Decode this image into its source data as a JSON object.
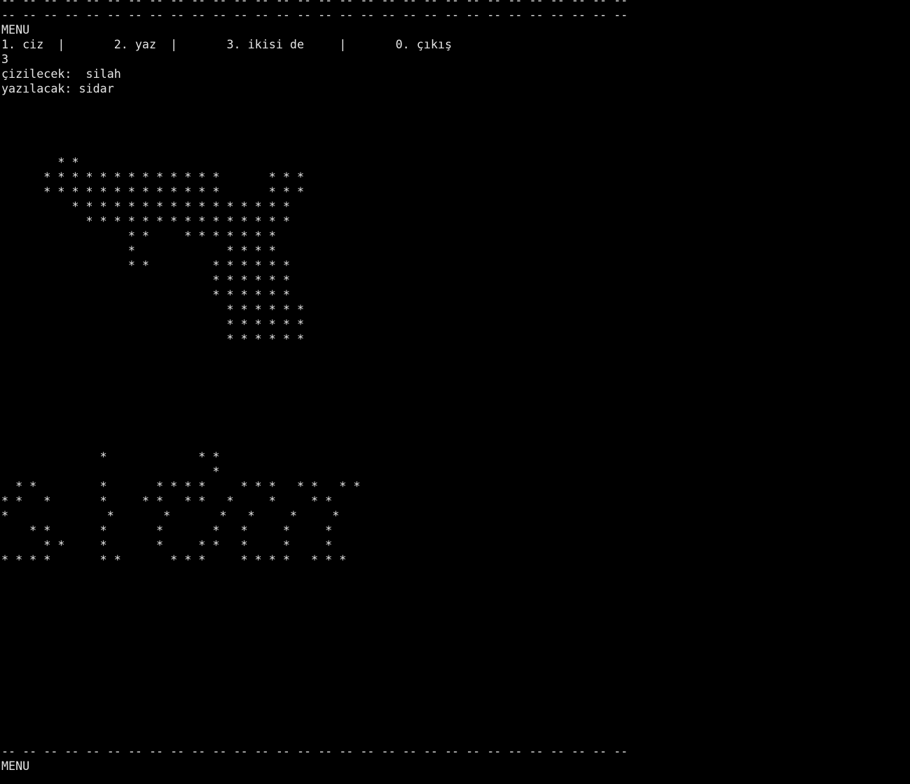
{
  "terminal": {
    "foreground": "#e6e6e6",
    "background": "#000000",
    "lines": [
      "-- -- -- -- -- -- -- -- -- -- -- -- -- -- -- -- -- -- -- -- -- -- -- -- -- -- -- -- -- --",
      "-- -- -- -- -- -- -- -- -- -- -- -- -- -- -- -- -- -- -- -- -- -- -- -- -- -- -- -- -- --",
      "MENU",
      "1. ciz  |       2. yaz  |       3. ikisi de     |       0. çıkış",
      "3",
      "çizilecek:  silah",
      "yazılacak: sidar",
      "",
      "",
      "",
      "",
      "        * *",
      "      * * * * * * * * * * * * *       * * *",
      "      * * * * * * * * * * * * *       * * *",
      "          * * * * * * * * * * * * * * * *",
      "            * * * * * * * * * * * * * * *",
      "                  * *     * * * * * * *",
      "                  *             * * * *",
      "                  * *         * * * * * *",
      "                              * * * * * *",
      "                              * * * * * *",
      "                                * * * * * *",
      "                                * * * * * *",
      "                                * * * * * *",
      "",
      "",
      "",
      "",
      "",
      "",
      "",
      "              *             * *",
      "                              *",
      "  * *         *       * * * *     * * *   * *   * *",
      "* *   *       *     * *   * *   *     *     * *",
      "*              *       *       *   *     *     *",
      "    * *       *       *       *   *     *     *",
      "      * *     *       *     * *   *     *     *",
      "* * * *       * *       * * *     * * * *   * * *",
      "",
      "",
      "",
      "",
      "",
      "",
      "",
      "",
      "",
      "",
      "",
      "",
      "-- -- -- -- -- -- -- -- -- -- -- -- -- -- -- -- -- -- -- -- -- -- -- -- -- -- -- -- -- --",
      "MENU"
    ]
  }
}
